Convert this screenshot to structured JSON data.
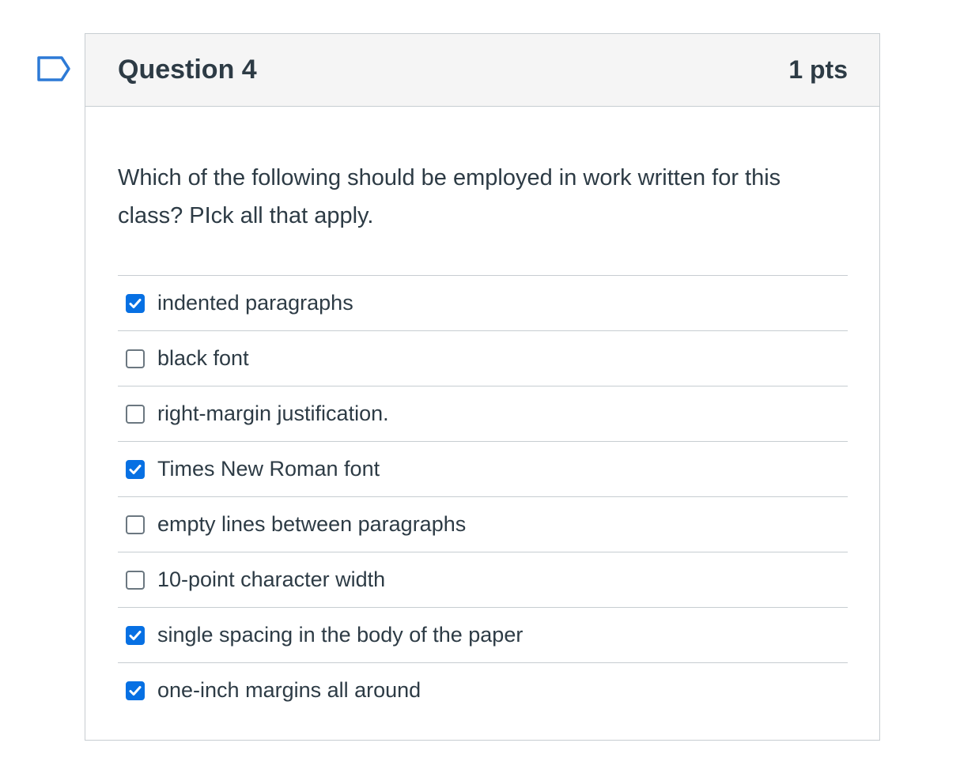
{
  "question": {
    "title": "Question 4",
    "points": "1 pts",
    "text": "Which of the following should be employed in work written for this class? PIck all that apply."
  },
  "answers": [
    {
      "label": "indented paragraphs",
      "checked": true
    },
    {
      "label": "black font",
      "checked": false
    },
    {
      "label": "right-margin justification.",
      "checked": false
    },
    {
      "label": "Times New Roman font",
      "checked": true
    },
    {
      "label": "empty lines between paragraphs",
      "checked": false
    },
    {
      "label": "10-point character width",
      "checked": false
    },
    {
      "label": "single spacing in the body of the paper",
      "checked": true
    },
    {
      "label": "one-inch margins all around",
      "checked": true
    }
  ],
  "colors": {
    "accent": "#0770e3",
    "text": "#2d3b45",
    "border": "#c7cdd1",
    "header_bg": "#f5f5f5"
  },
  "icons": {
    "flag": "flag-question-icon",
    "check": "checkmark-icon"
  }
}
